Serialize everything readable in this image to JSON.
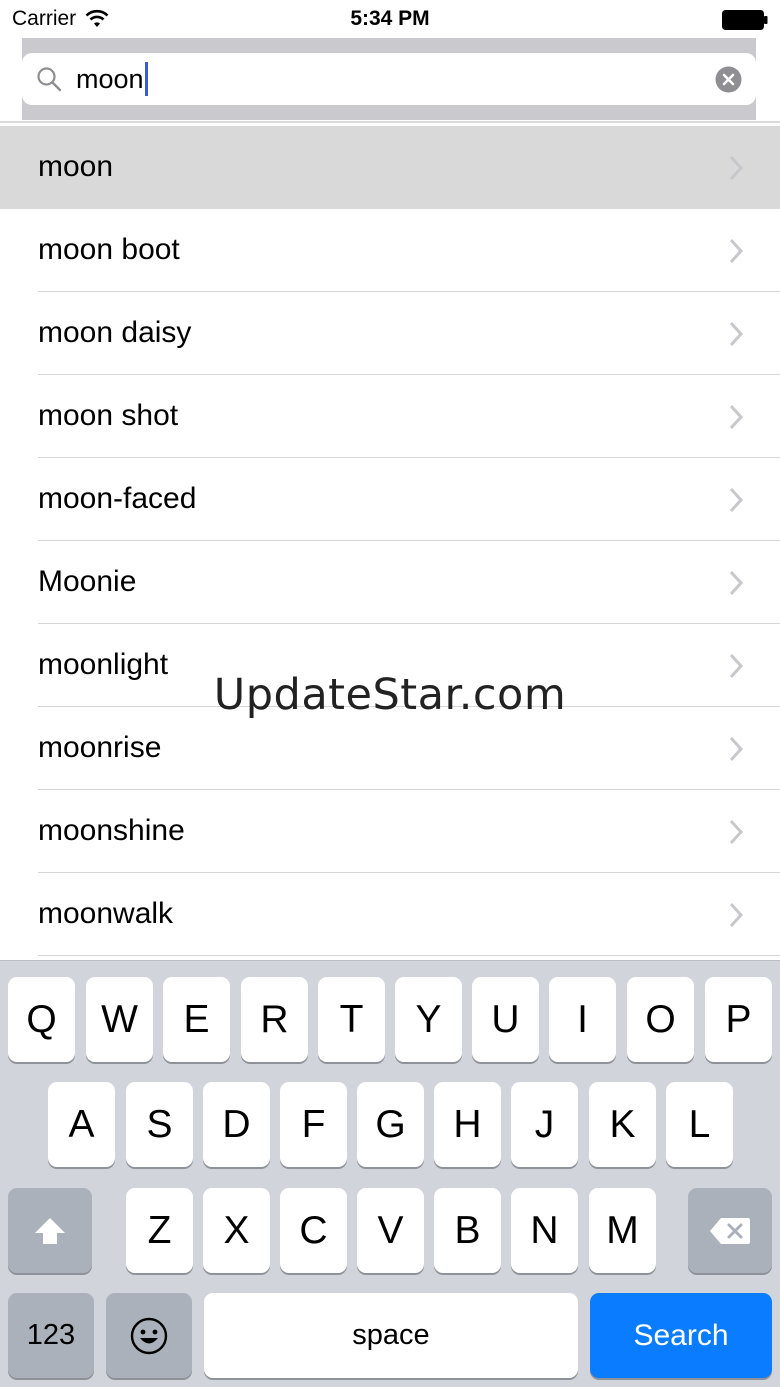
{
  "status_bar": {
    "carrier": "Carrier",
    "time": "5:34 PM",
    "wifi_icon": "wifi-icon",
    "battery_icon": "battery-icon"
  },
  "search": {
    "value": "moon",
    "search_icon": "search-icon",
    "clear_icon": "clear-icon"
  },
  "results": [
    {
      "label": "moon",
      "selected": true
    },
    {
      "label": "moon boot"
    },
    {
      "label": "moon daisy"
    },
    {
      "label": "moon shot"
    },
    {
      "label": "moon-faced"
    },
    {
      "label": "Moonie"
    },
    {
      "label": "moonlight"
    },
    {
      "label": "moonrise"
    },
    {
      "label": "moonshine"
    },
    {
      "label": "moonwalk"
    }
  ],
  "watermark": "UpdateStar.com",
  "keyboard": {
    "row1": [
      "Q",
      "W",
      "E",
      "R",
      "T",
      "Y",
      "U",
      "I",
      "O",
      "P"
    ],
    "row2": [
      "A",
      "S",
      "D",
      "F",
      "G",
      "H",
      "J",
      "K",
      "L"
    ],
    "row3": [
      "Z",
      "X",
      "C",
      "V",
      "B",
      "N",
      "M"
    ],
    "numbers_label": "123",
    "space_label": "space",
    "search_label": "Search",
    "accent_color": "#0a7cff"
  }
}
